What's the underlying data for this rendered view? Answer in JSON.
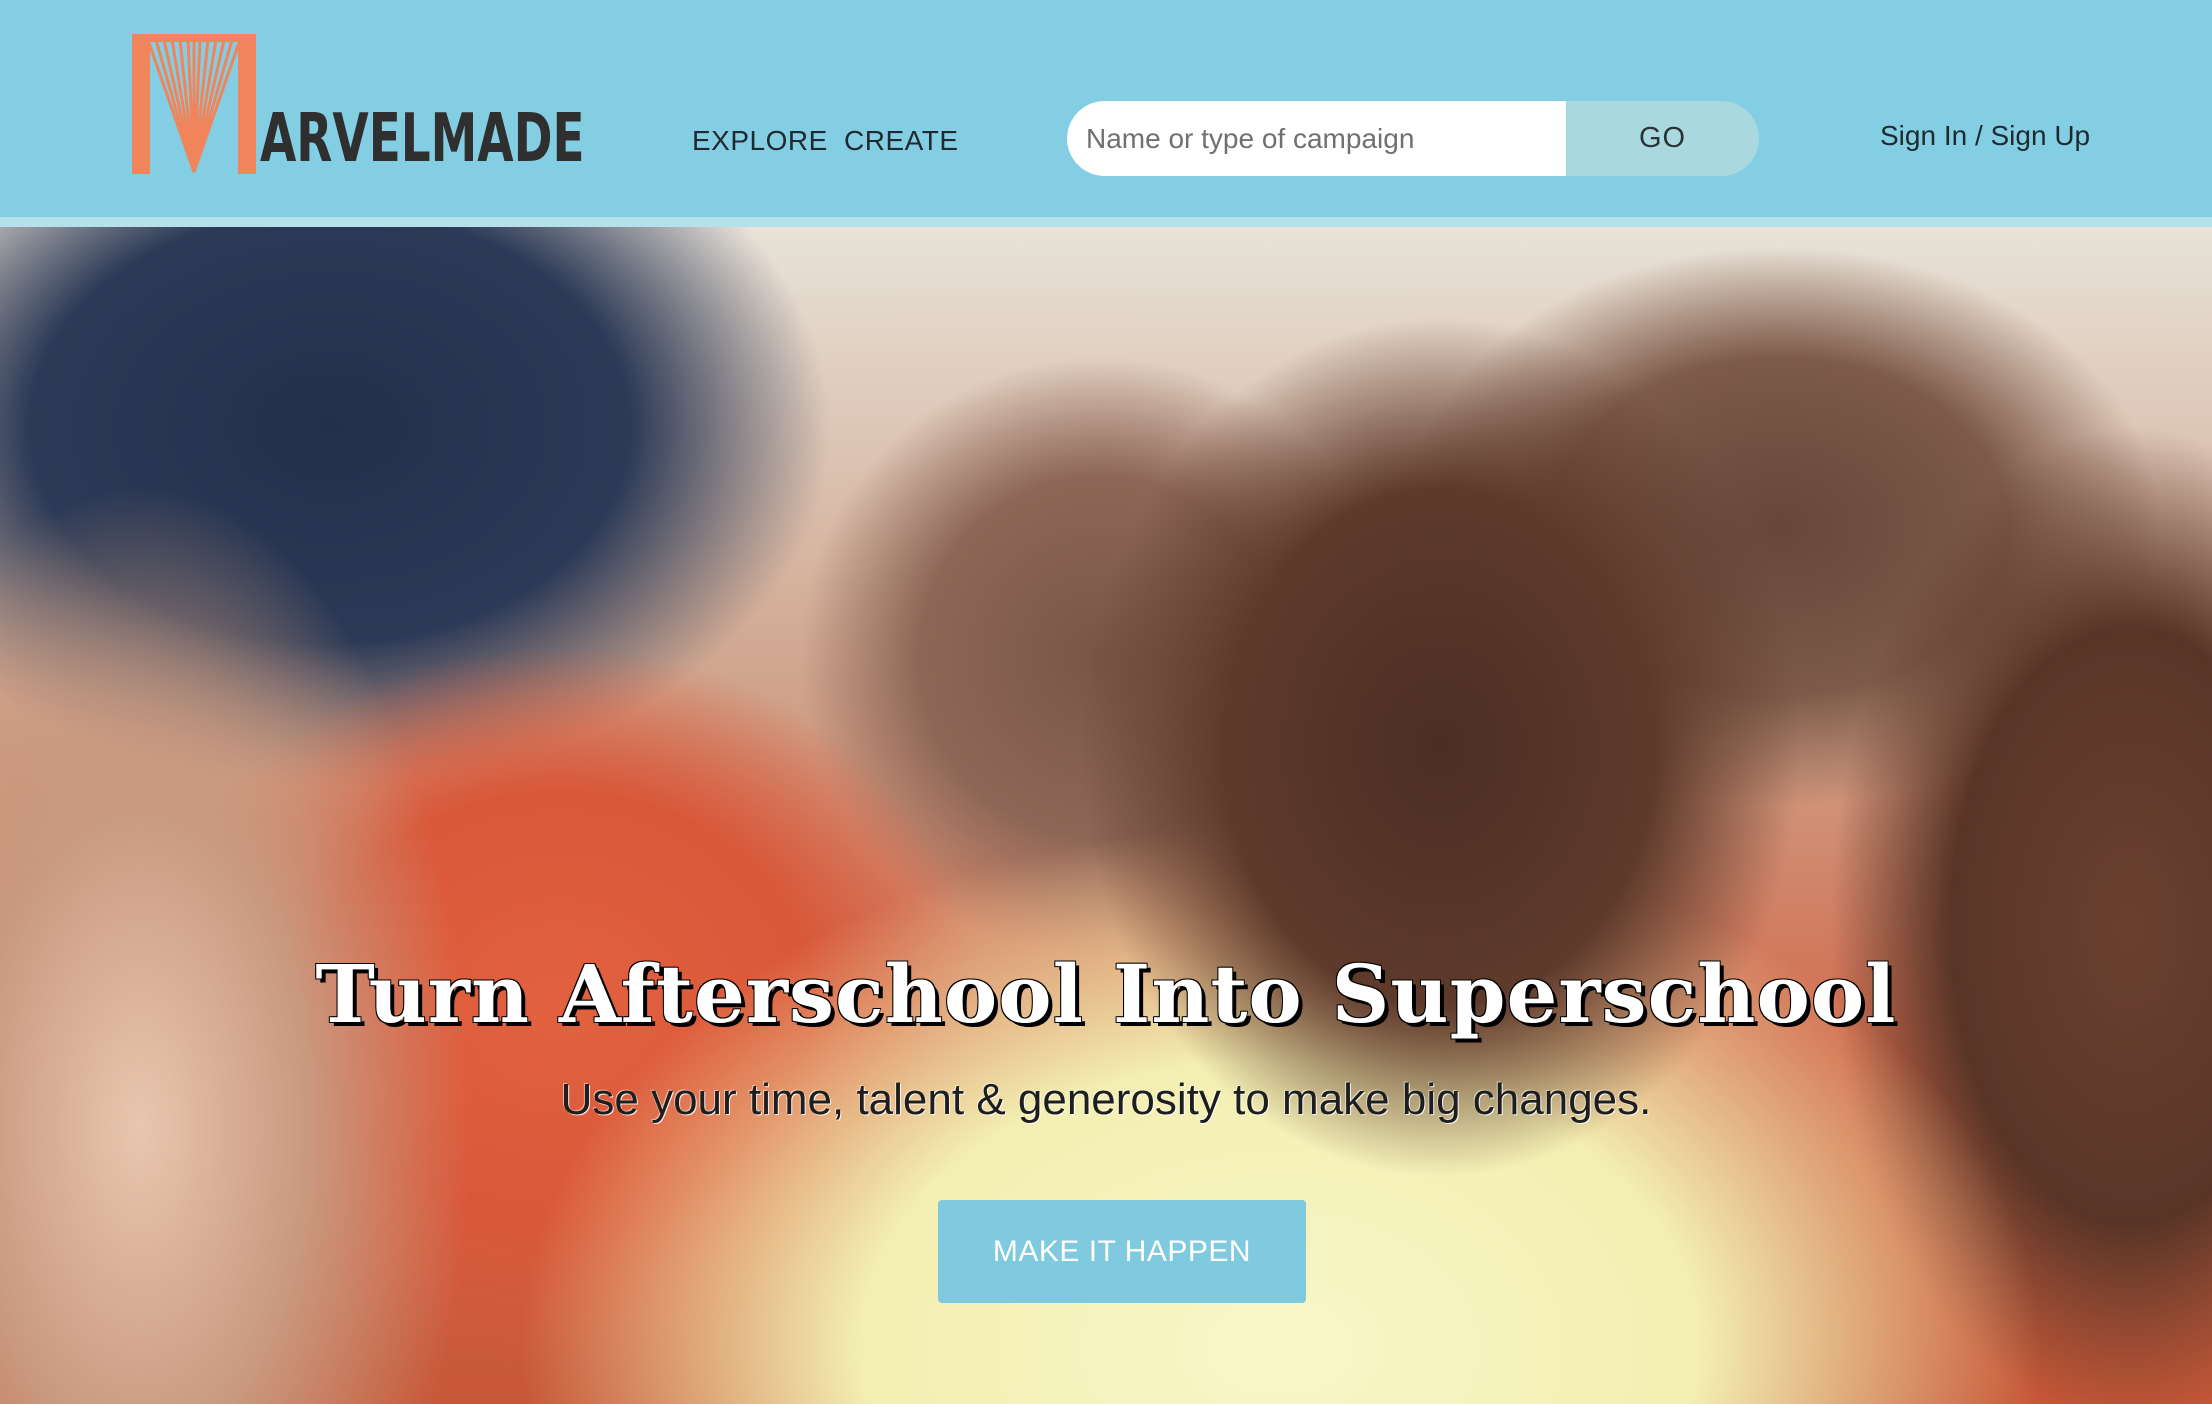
{
  "header": {
    "logo_text": "ARVELMADE",
    "logo_full_name": "MARVELMADE",
    "nav": {
      "explore": "EXPLORE",
      "create": "CREATE"
    },
    "search": {
      "placeholder": "Name or type of campaign",
      "value": "",
      "button": "GO"
    },
    "auth": "Sign In / Sign Up"
  },
  "hero": {
    "title": "Turn Afterschool Into Superschool",
    "subtitle": "Use your time, talent & generosity to make big changes.",
    "cta": "MAKE IT HAPPEN"
  },
  "colors": {
    "header_bg": "#84cee3",
    "header_rule": "#b6e0ea",
    "search_button_bg": "#a9d9df",
    "logo_orange": "#f0845a",
    "cta_bg": "#7fcadf"
  },
  "icons": {
    "logo_mark": "book-fan-logo-icon"
  }
}
